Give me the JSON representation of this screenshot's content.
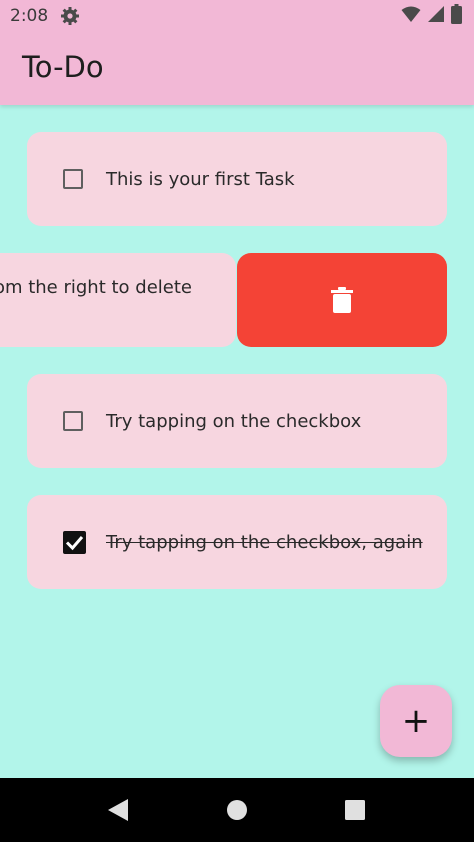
{
  "status_bar": {
    "time": "2:08"
  },
  "app_bar": {
    "title": "To-Do"
  },
  "tasks": [
    {
      "label": "This is your first Task",
      "checked": false
    },
    {
      "label": "from the right to delete",
      "checked": false,
      "swiped": true
    },
    {
      "label": "Try tapping on the checkbox",
      "checked": false
    },
    {
      "label": "Try tapping on the checkbox, again",
      "checked": true
    }
  ],
  "fab": {
    "label": "+"
  },
  "colors": {
    "app_bar": "#f2b8d6",
    "background": "#b2f5ea",
    "card": "#f7d6e0",
    "delete": "#f44336"
  },
  "icons": {
    "status": [
      "gear-icon",
      "wifi-icon",
      "signal-icon",
      "battery-icon"
    ],
    "delete": "trash-icon",
    "nav": [
      "back-icon",
      "home-icon",
      "recents-icon"
    ]
  }
}
